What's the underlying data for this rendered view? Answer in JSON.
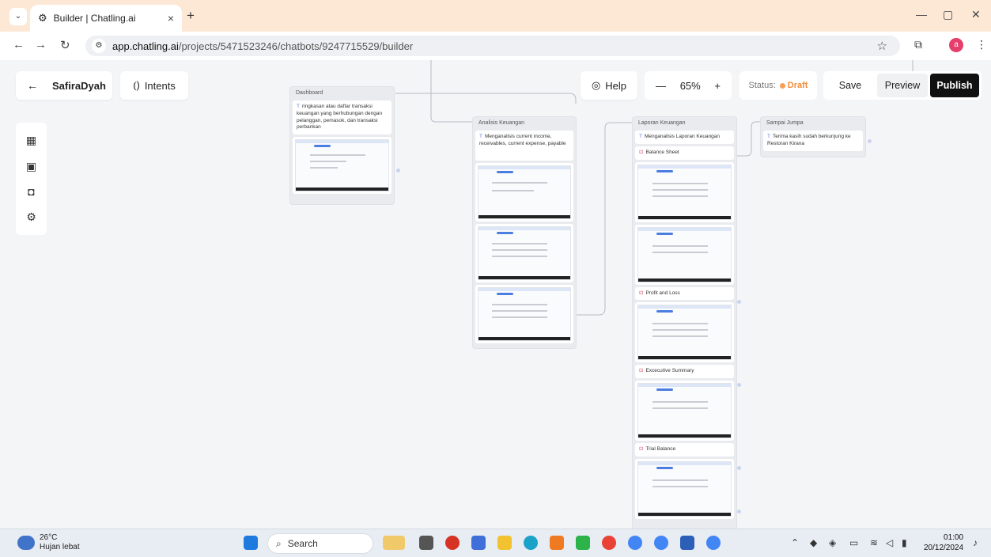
{
  "browser": {
    "tab_title": "Builder | Chatling.ai",
    "tab_close": "×",
    "new_tab": "+",
    "url_domain": "app.chatling.ai",
    "url_path": "/projects/5471523246/chatbots/9247715529/builder",
    "win_min": "—",
    "win_max": "▢",
    "win_close": "✕",
    "profile_initial": "a"
  },
  "header": {
    "back_arrow": "←",
    "project_name": "SafiraDyah",
    "intents_label": "Intents",
    "help_label": "Help",
    "zoom_minus": "—",
    "zoom_level": "65%",
    "zoom_plus": "+",
    "status_label": "Status:",
    "status_value": "Draft",
    "save_label": "Save",
    "preview_label": "Preview",
    "publish_label": "Publish"
  },
  "nodes": {
    "dashboard": {
      "title": "Dashboard",
      "text": "ringkasan atau daftar transaksi keuangan yang berhubungan dengan pelanggan, pemasok, dan transaksi perbankan"
    },
    "analisis": {
      "title": "Analisis Keuangan",
      "text": "Menganalisis current income, receivables, current expense, payable"
    },
    "laporan": {
      "title": "Laporan Keuangan",
      "text": "Menganalisis Laporan Keuangan",
      "buttons": [
        "Balance Sheet",
        "Profit and Loss",
        "Excecutive Summary",
        "Trial Balance"
      ]
    },
    "sampai": {
      "title": "Sampai Jumpa",
      "text": "Terima kasih sudah berkunjung ke Restoran Kirana"
    }
  },
  "taskbar": {
    "temperature": "26°C",
    "weather": "Hujan lebat",
    "search_placeholder": "Search",
    "time": "01:00",
    "date": "20/12/2024"
  },
  "colors": {
    "accent_draft": "#f28c3a",
    "publish_bg": "#111111",
    "tab_strip": "#fde8d6"
  }
}
